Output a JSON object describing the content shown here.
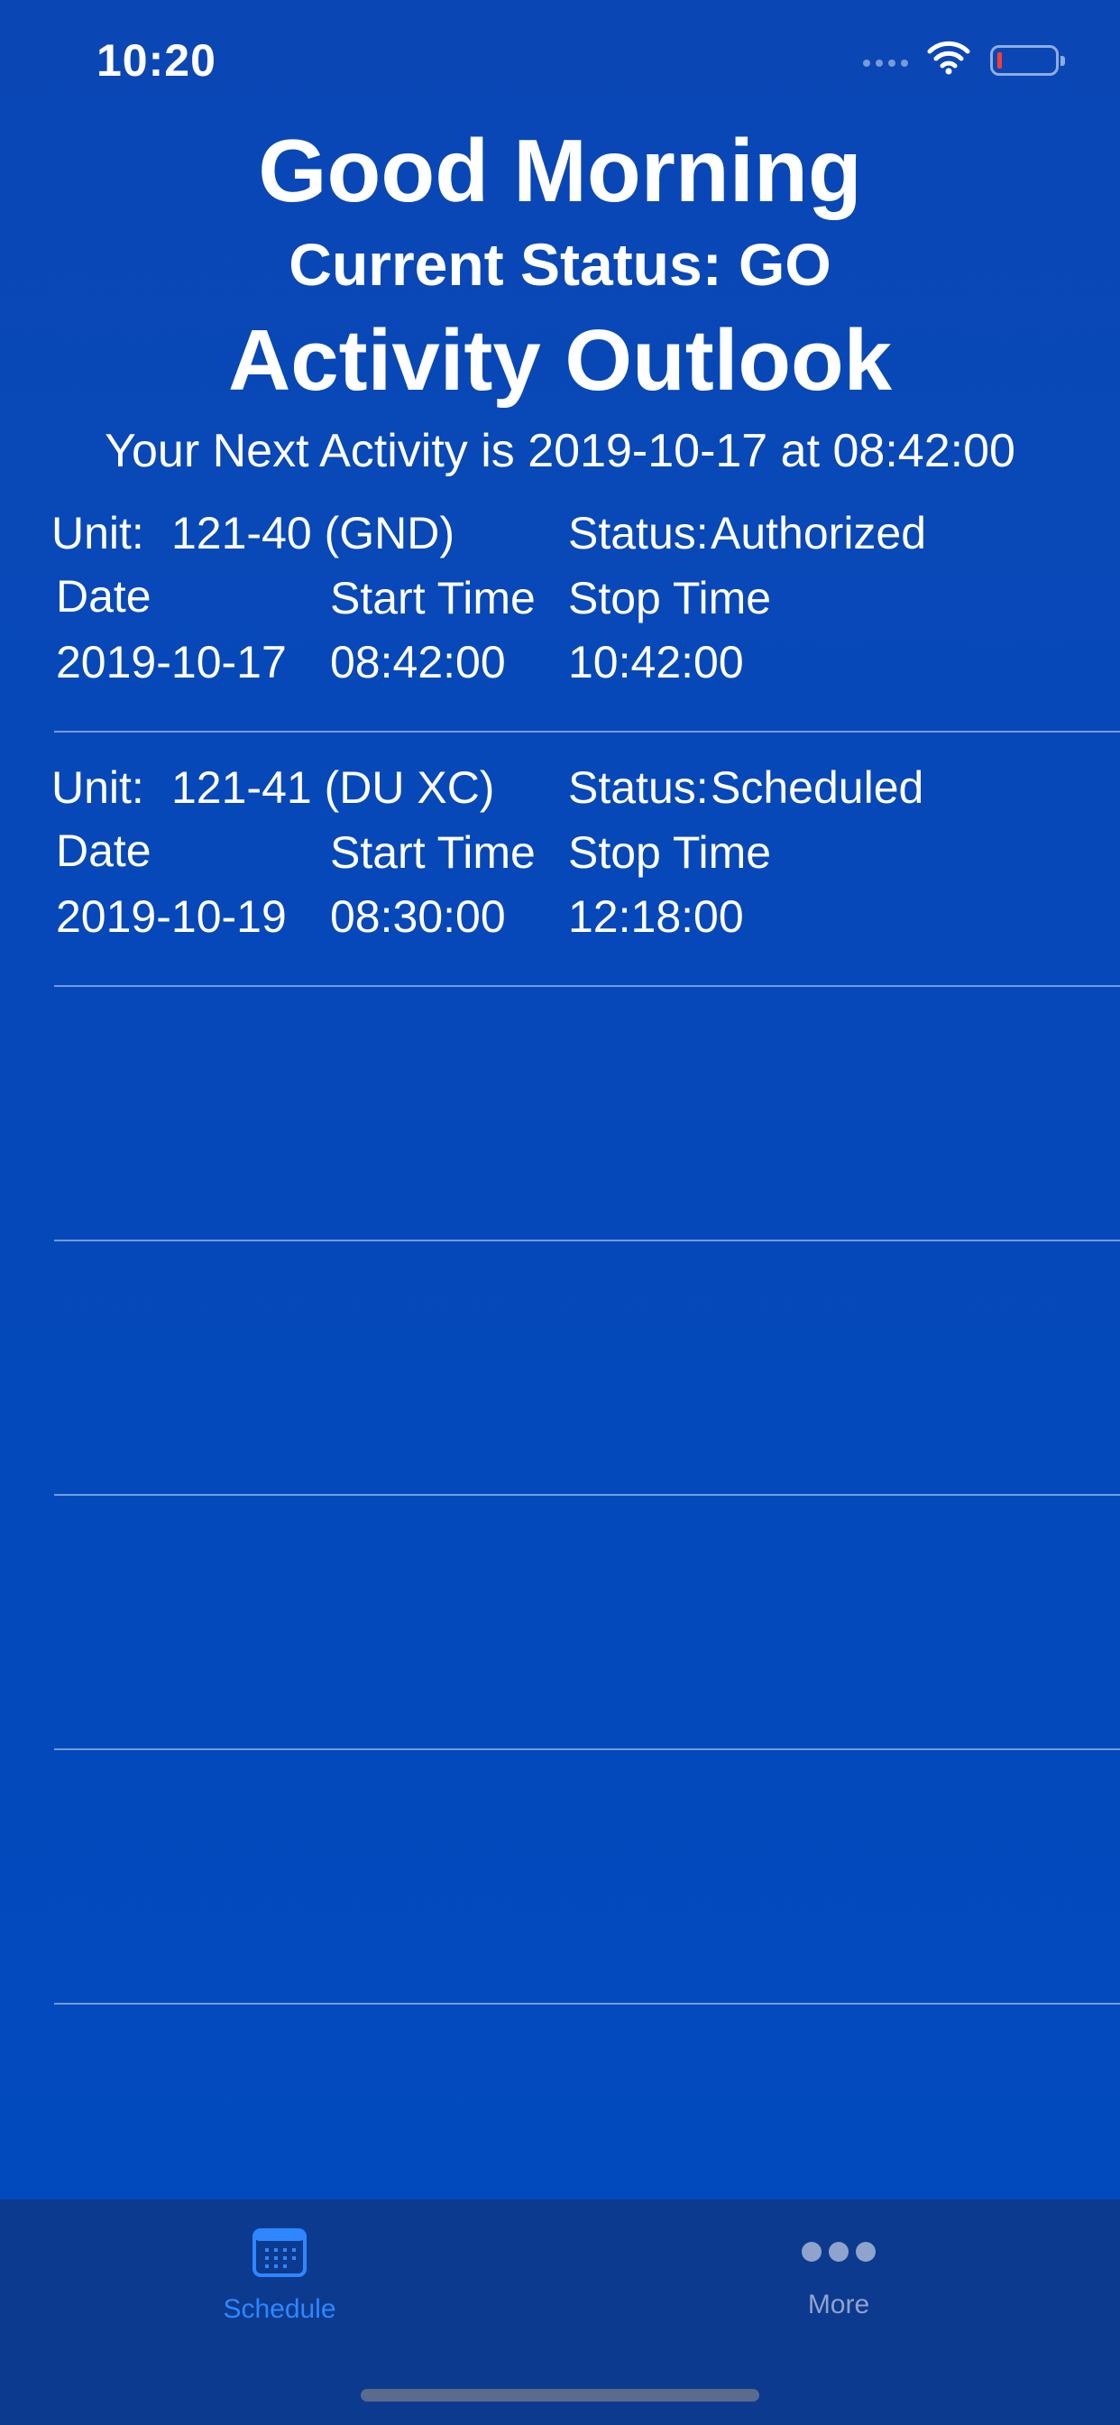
{
  "status_bar": {
    "time": "10:20"
  },
  "header": {
    "greeting": "Good Morning",
    "current_status": "Current Status: GO",
    "title": "Activity Outlook",
    "next_activity": "Your Next Activity is 2019-10-17 at 08:42:00"
  },
  "columns": {
    "unit_label": "Unit:",
    "status_label": "Status:",
    "date": "Date",
    "start_time": "Start Time",
    "stop_time": "Stop Time"
  },
  "activities": [
    {
      "unit": "121-40 (GND)",
      "status": "Authorized",
      "date": "2019-10-17",
      "start": "08:42:00",
      "stop": "10:42:00"
    },
    {
      "unit": "121-41 (DU XC)",
      "status": "Scheduled",
      "date": "2019-10-19",
      "start": "08:30:00",
      "stop": "12:18:00"
    }
  ],
  "tab_bar": {
    "tabs": [
      {
        "label": "Schedule",
        "icon": "calendar-icon",
        "active": true
      },
      {
        "label": "More",
        "icon": "more-icon",
        "active": false
      }
    ]
  },
  "colors": {
    "background": "#0047BC",
    "tab_active": "#2E87FF",
    "tab_inactive": "#8FA3CC",
    "tab_bar": "#0C3A8E"
  }
}
